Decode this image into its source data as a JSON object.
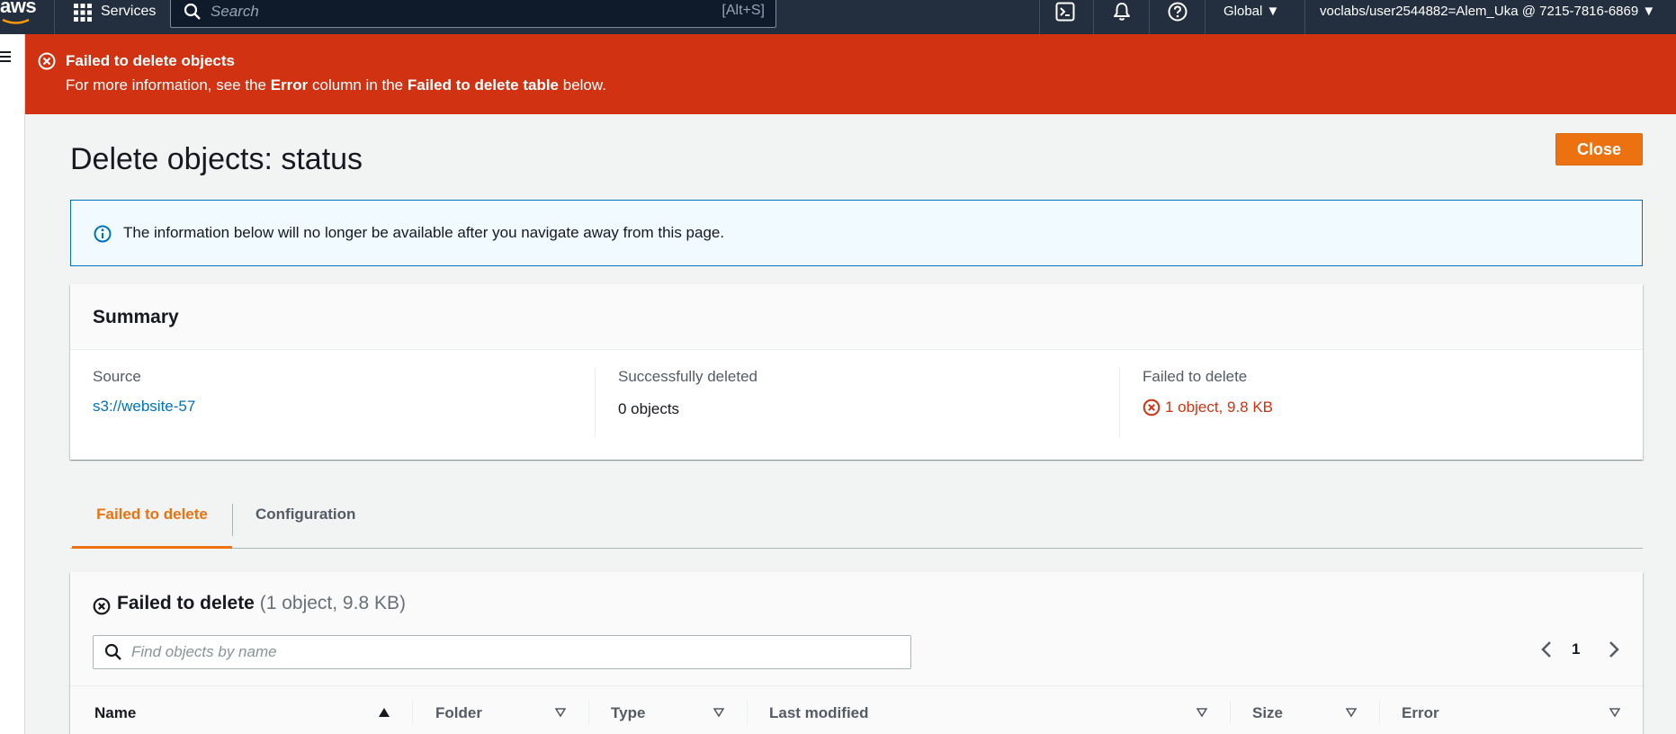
{
  "topnav": {
    "logo": "aws",
    "services_label": "Services",
    "search_placeholder": "Search",
    "search_shortcut": "[Alt+S]",
    "region": "Global",
    "account": "voclabs/user2544882=Alem_Uka @ 7215-7816-6869"
  },
  "flash": {
    "title": "Failed to delete objects",
    "message_prefix": "For more information, see the ",
    "message_bold1": "Error",
    "message_mid": " column in the ",
    "message_bold2": "Failed to delete table",
    "message_suffix": " below."
  },
  "page": {
    "title": "Delete objects: status",
    "close_label": "Close",
    "info_text": "The information below will no longer be available after you navigate away from this page."
  },
  "summary": {
    "title": "Summary",
    "source_label": "Source",
    "source_value": "s3://website-57",
    "success_label": "Successfully deleted",
    "success_value": "0 objects",
    "failed_label": "Failed to delete",
    "failed_value": "1 object, 9.8 KB"
  },
  "tabs": [
    {
      "label": "Failed to delete",
      "active": true
    },
    {
      "label": "Configuration",
      "active": false
    }
  ],
  "failed_table": {
    "title": "Failed to delete",
    "count": "(1 object, 9.8 KB)",
    "filter_placeholder": "Find objects by name",
    "page": "1",
    "columns": [
      "Name",
      "Folder",
      "Type",
      "Last modified",
      "Size",
      "Error"
    ]
  },
  "colors": {
    "nav_bg": "#232f3e",
    "error_red": "#d13212",
    "accent_orange": "#ec7211",
    "link_blue": "#0073bb"
  }
}
